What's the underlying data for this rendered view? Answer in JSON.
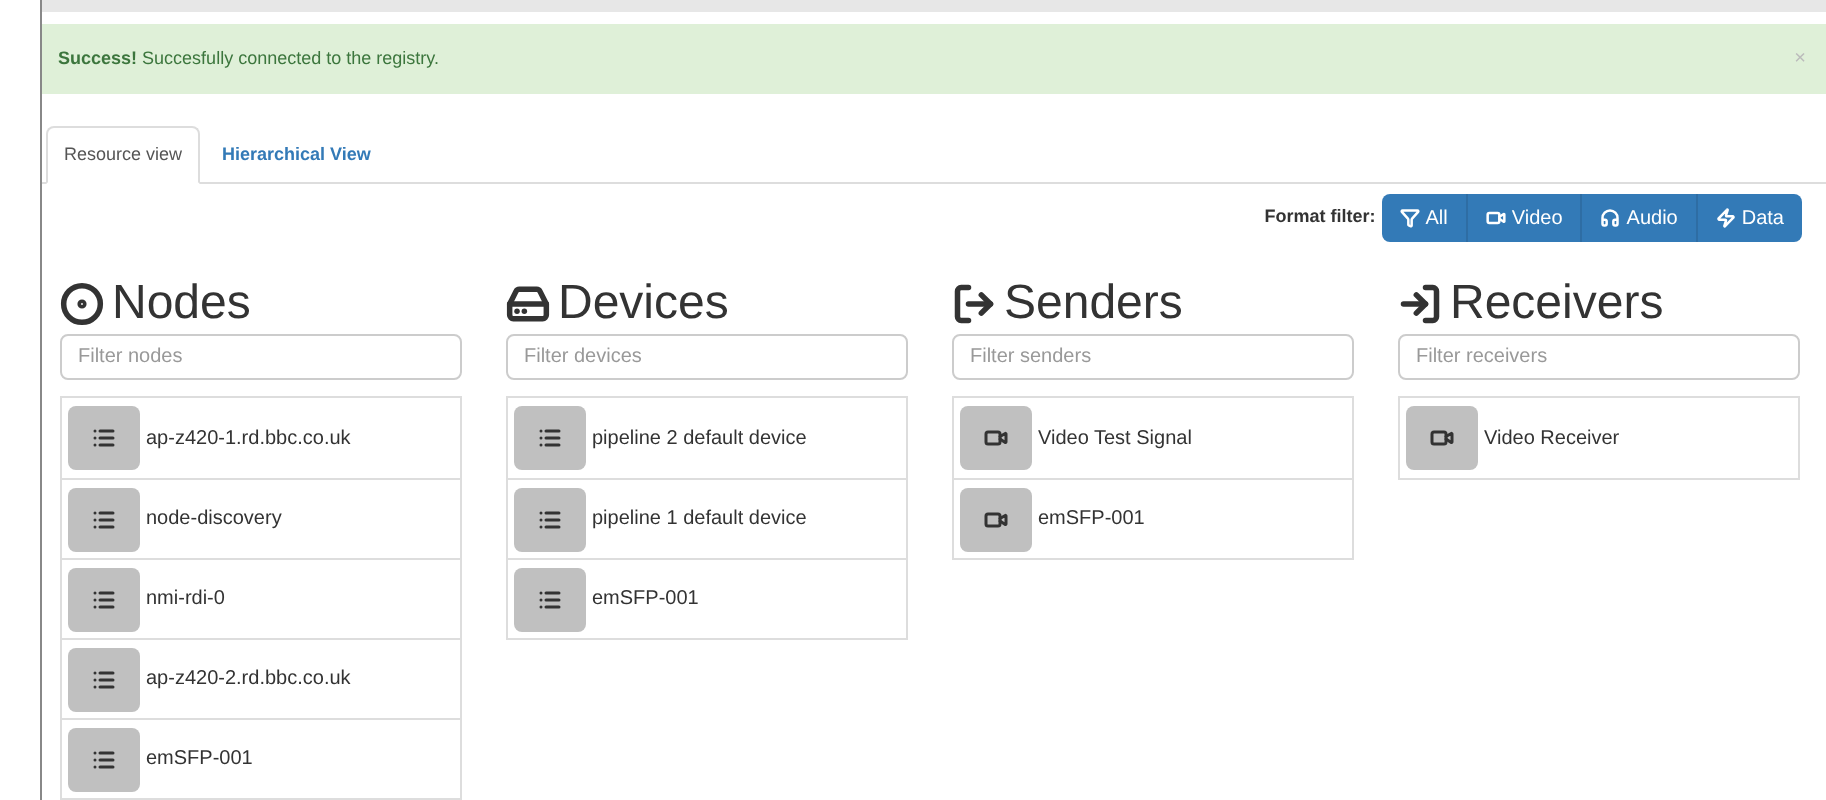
{
  "alert": {
    "strong": "Success!",
    "message": "Succesfully connected to the registry.",
    "close": "×"
  },
  "tabs": [
    {
      "label": "Resource view",
      "selected": true
    },
    {
      "label": "Hierarchical View",
      "selected": false
    }
  ],
  "format_filter": {
    "label": "Format filter:",
    "buttons": [
      {
        "kind": "all",
        "label": "All"
      },
      {
        "kind": "video",
        "label": "Video"
      },
      {
        "kind": "audio",
        "label": "Audio"
      },
      {
        "kind": "data",
        "label": "Data"
      }
    ]
  },
  "columns": [
    {
      "kind": "nodes",
      "title": "Nodes",
      "placeholder": "Filter nodes",
      "items": [
        {
          "kind": "list",
          "label": "ap-z420-1.rd.bbc.co.uk"
        },
        {
          "kind": "list",
          "label": "node-discovery"
        },
        {
          "kind": "list",
          "label": "nmi-rdi-0"
        },
        {
          "kind": "list",
          "label": "ap-z420-2.rd.bbc.co.uk"
        },
        {
          "kind": "list",
          "label": "emSFP-001"
        }
      ]
    },
    {
      "kind": "devices",
      "title": "Devices",
      "placeholder": "Filter devices",
      "items": [
        {
          "kind": "list",
          "label": "pipeline 2 default device"
        },
        {
          "kind": "list",
          "label": "pipeline 1 default device"
        },
        {
          "kind": "list",
          "label": "emSFP-001"
        }
      ]
    },
    {
      "kind": "senders",
      "title": "Senders",
      "placeholder": "Filter senders",
      "items": [
        {
          "kind": "video",
          "label": "Video Test Signal"
        },
        {
          "kind": "video",
          "label": "emSFP-001"
        }
      ]
    },
    {
      "kind": "receivers",
      "title": "Receivers",
      "placeholder": "Filter receivers",
      "items": [
        {
          "kind": "video",
          "label": "Video Receiver"
        }
      ]
    }
  ]
}
